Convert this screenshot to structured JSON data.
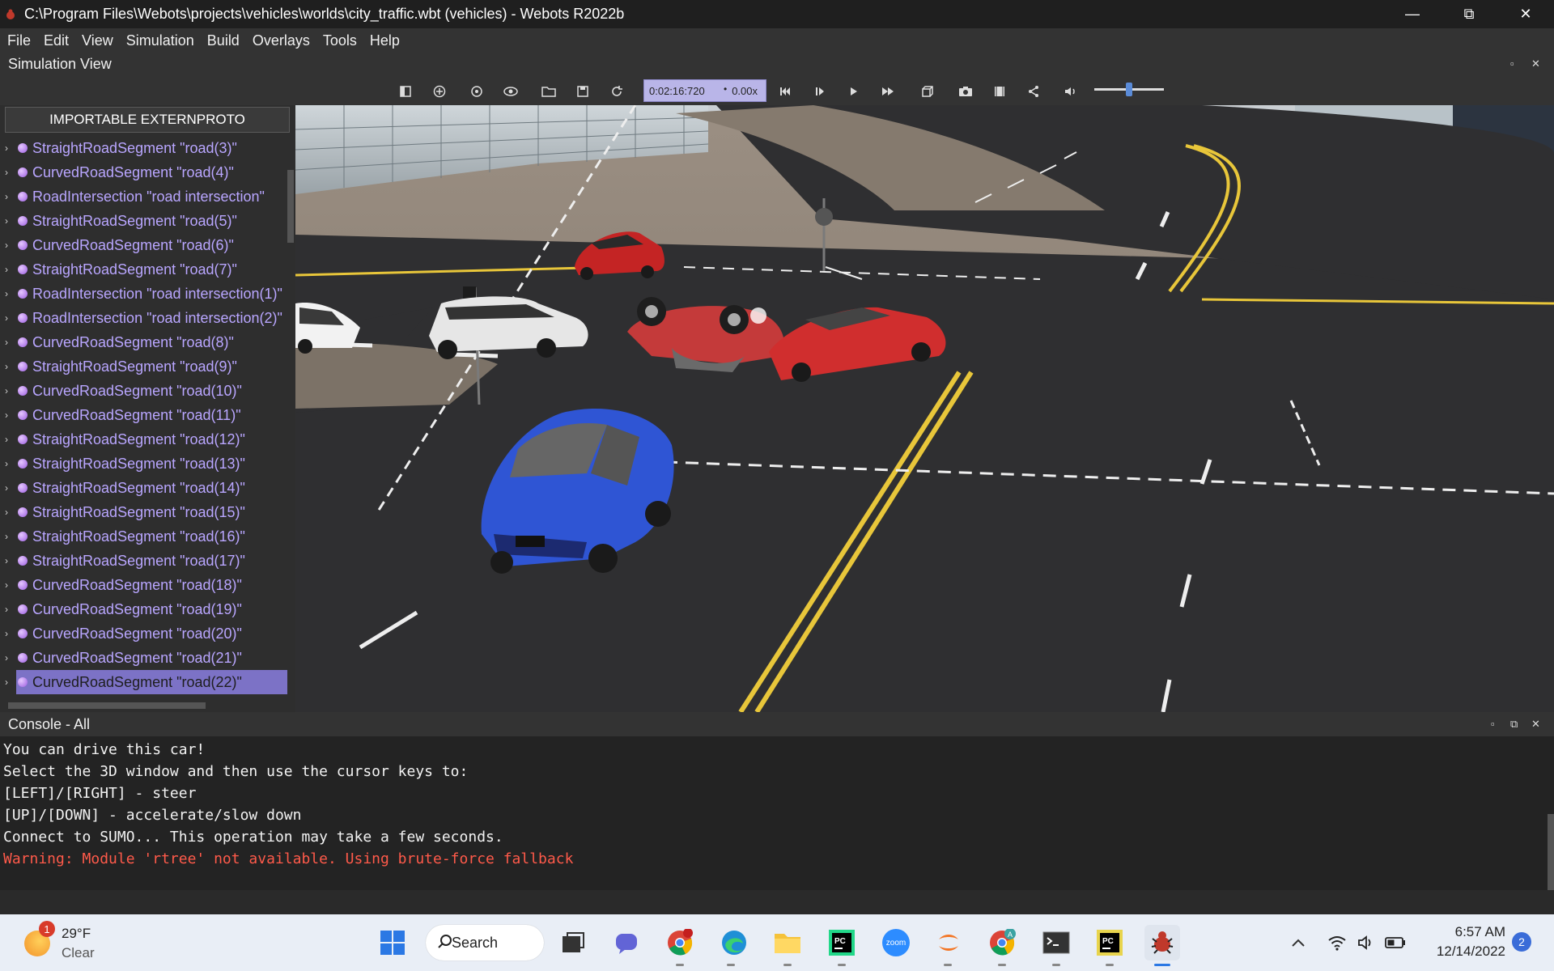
{
  "window": {
    "title": "C:\\Program Files\\Webots\\projects\\vehicles\\worlds\\city_traffic.wbt (vehicles) - Webots R2022b"
  },
  "menu": [
    "File",
    "Edit",
    "View",
    "Simulation",
    "Build",
    "Overlays",
    "Tools",
    "Help"
  ],
  "simulation_view": {
    "label": "Simulation View",
    "time": "0:02:16:720",
    "speed": "0.00x",
    "volume_level": 0.45
  },
  "scene_tree": {
    "header": "IMPORTABLE EXTERNPROTO",
    "items": [
      "StraightRoadSegment \"road(3)\"",
      "CurvedRoadSegment \"road(4)\"",
      "RoadIntersection \"road intersection\"",
      "StraightRoadSegment \"road(5)\"",
      "CurvedRoadSegment \"road(6)\"",
      "StraightRoadSegment \"road(7)\"",
      "RoadIntersection \"road intersection(1)\"",
      "RoadIntersection \"road intersection(2)\"",
      "CurvedRoadSegment \"road(8)\"",
      "StraightRoadSegment \"road(9)\"",
      "CurvedRoadSegment \"road(10)\"",
      "CurvedRoadSegment \"road(11)\"",
      "StraightRoadSegment \"road(12)\"",
      "StraightRoadSegment \"road(13)\"",
      "StraightRoadSegment \"road(14)\"",
      "StraightRoadSegment \"road(15)\"",
      "StraightRoadSegment \"road(16)\"",
      "StraightRoadSegment \"road(17)\"",
      "CurvedRoadSegment \"road(18)\"",
      "CurvedRoadSegment \"road(19)\"",
      "CurvedRoadSegment \"road(20)\"",
      "CurvedRoadSegment \"road(21)\"",
      "CurvedRoadSegment \"road(22)\""
    ],
    "selected_index": 22
  },
  "console": {
    "label": "Console - All",
    "lines": [
      {
        "text": "You can drive this car!",
        "type": "info"
      },
      {
        "text": "Select the 3D window and then use the cursor keys to:",
        "type": "info"
      },
      {
        "text": "[LEFT]/[RIGHT] - steer",
        "type": "info"
      },
      {
        "text": "[UP]/[DOWN] - accelerate/slow down",
        "type": "info"
      },
      {
        "text": "Connect to SUMO... This operation may take a few seconds.",
        "type": "info"
      },
      {
        "text": "Warning: Module 'rtree' not available. Using brute-force fallback",
        "type": "warning"
      }
    ]
  },
  "taskbar": {
    "weather_badge": "1",
    "temperature": "29°F",
    "condition": "Clear",
    "search_label": "Search",
    "zoom_label": "zoom",
    "chrome_badge": "A",
    "time": "6:57 AM",
    "date": "12/14/2022",
    "notifications": "2"
  },
  "colors": {
    "tree_text": "#b9a6ff",
    "tree_selected": "#7c72c6",
    "timebox": "#b9b5e8",
    "warning": "#ff5a4a",
    "road": "#2f2f31",
    "yellow_line": "#e8c63a"
  }
}
